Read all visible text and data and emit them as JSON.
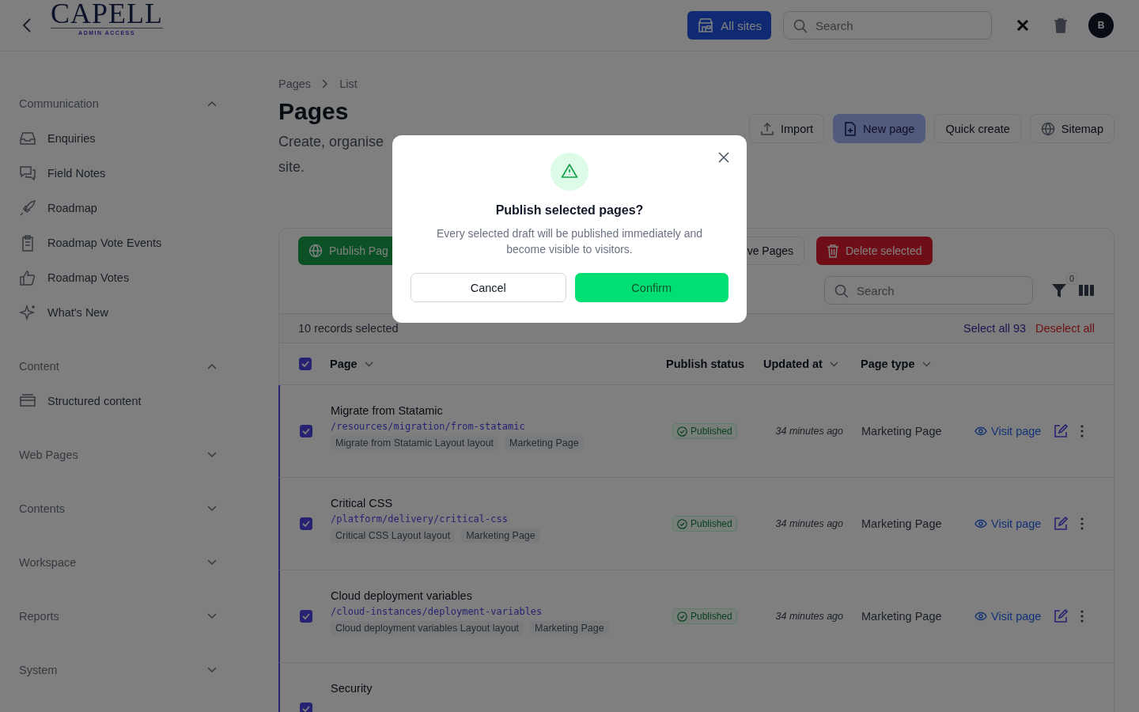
{
  "header": {
    "logo": {
      "name": "CAPELL",
      "tagline": "ADMIN ACCESS"
    },
    "sites_button": "All sites",
    "search": {
      "placeholder": "Search"
    },
    "avatar": "B"
  },
  "sidebar": {
    "groups": [
      {
        "label": "Communication",
        "expanded": true,
        "items": [
          "Enquiries",
          "Field Notes",
          "Roadmap",
          "Roadmap Vote Events",
          "Roadmap Votes",
          "What's New"
        ]
      },
      {
        "label": "Content",
        "expanded": true,
        "items": [
          "Structured content"
        ]
      },
      {
        "label": "Web Pages",
        "expanded": false
      },
      {
        "label": "Contents",
        "expanded": false
      },
      {
        "label": "Workspace",
        "expanded": false
      },
      {
        "label": "Reports",
        "expanded": false
      },
      {
        "label": "System",
        "expanded": false
      }
    ]
  },
  "breadcrumbs": [
    "Pages",
    "List"
  ],
  "page": {
    "title": "Pages",
    "subtitle_lines": [
      "Create, organise",
      "site."
    ]
  },
  "actions": [
    {
      "label": "Import",
      "kind": "outline"
    },
    {
      "label": "New page",
      "kind": "primary"
    },
    {
      "label": "Quick create",
      "kind": "outline"
    },
    {
      "label": "Sitemap",
      "kind": "outline"
    }
  ],
  "bulk_actions": [
    {
      "label": "Publish Pag",
      "kind": "publish"
    },
    {
      "label": "ve Pages",
      "kind": "outline"
    },
    {
      "label": "Delete selected",
      "kind": "danger"
    }
  ],
  "table": {
    "search": {
      "placeholder": "Search"
    },
    "filter_count": "0",
    "selection": {
      "text": "10 records selected",
      "select_all": "Select all 93",
      "deselect_all": "Deselect all"
    },
    "all_checked": true,
    "columns": [
      {
        "label": "Page",
        "sortable": true
      },
      {
        "label": "Publish status",
        "sortable": false
      },
      {
        "label": "Updated at",
        "sortable": true
      },
      {
        "label": "Page type",
        "sortable": true
      }
    ],
    "rows": [
      {
        "name": "Migrate from Statamic",
        "path": "/resources/migration/from-statamic",
        "tags": [
          "Migrate from Statamic Layout layout",
          "Marketing Page"
        ],
        "status": "Published",
        "updated": "34 minutes ago",
        "type": "Marketing Page",
        "visit": "Visit page",
        "checked": true
      },
      {
        "name": "Critical CSS",
        "path": "/platform/delivery/critical-css",
        "tags": [
          "Critical CSS Layout layout",
          "Marketing Page"
        ],
        "status": "Published",
        "updated": "34 minutes ago",
        "type": "Marketing Page",
        "visit": "Visit page",
        "checked": true
      },
      {
        "name": "Cloud deployment variables",
        "path": "/cloud-instances/deployment-variables",
        "tags": [
          "Cloud deployment variables Layout layout",
          "Marketing Page"
        ],
        "status": "Published",
        "updated": "34 minutes ago",
        "type": "Marketing Page",
        "visit": "Visit page",
        "checked": true
      },
      {
        "name": "Security",
        "checked": true
      }
    ]
  },
  "modal": {
    "title": "Publish selected pages?",
    "message": "Every selected draft will be published immediately and become visible to visitors.",
    "cancel": "Cancel",
    "confirm": "Confirm"
  }
}
